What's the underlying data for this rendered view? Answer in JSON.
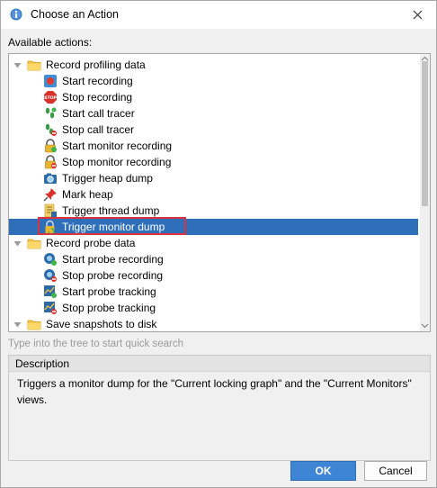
{
  "window": {
    "title": "Choose an Action",
    "title_icon": "info-icon",
    "close_icon": "close-icon"
  },
  "actions_label": "Available actions:",
  "tree": {
    "groups": [
      {
        "label": "Record profiling data",
        "icon": "folder-icon",
        "expanded": true,
        "items": [
          {
            "label": "Start recording",
            "icon": "start-recording-icon"
          },
          {
            "label": "Stop recording",
            "icon": "stop-recording-icon"
          },
          {
            "label": "Start call tracer",
            "icon": "footprints-start-icon"
          },
          {
            "label": "Stop call tracer",
            "icon": "footprints-stop-icon"
          },
          {
            "label": "Start monitor recording",
            "icon": "lock-start-icon"
          },
          {
            "label": "Stop monitor recording",
            "icon": "lock-stop-icon"
          },
          {
            "label": "Trigger heap dump",
            "icon": "camera-icon"
          },
          {
            "label": "Mark heap",
            "icon": "pin-icon"
          },
          {
            "label": "Trigger thread dump",
            "icon": "thread-dump-icon"
          },
          {
            "label": "Trigger monitor dump",
            "icon": "monitor-dump-icon",
            "selected": true
          }
        ]
      },
      {
        "label": "Record probe data",
        "icon": "folder-icon",
        "expanded": true,
        "items": [
          {
            "label": "Start probe recording",
            "icon": "probe-start-icon"
          },
          {
            "label": "Stop probe recording",
            "icon": "probe-stop-icon"
          },
          {
            "label": "Start probe tracking",
            "icon": "probe-track-start-icon"
          },
          {
            "label": "Stop probe tracking",
            "icon": "probe-track-stop-icon"
          }
        ]
      },
      {
        "label": "Save snapshots to disk",
        "icon": "folder-icon",
        "expanded": true,
        "items": []
      }
    ]
  },
  "search_hint": "Type into the tree to start quick search",
  "description": {
    "title": "Description",
    "text": "Triggers a monitor dump for the \"Current locking graph\" and the \"Current Monitors\" views."
  },
  "buttons": {
    "ok": "OK",
    "cancel": "Cancel"
  },
  "colors": {
    "selection": "#2f6fb9",
    "highlight_outline": "#d9333f",
    "ok_button": "#3f85d6"
  }
}
